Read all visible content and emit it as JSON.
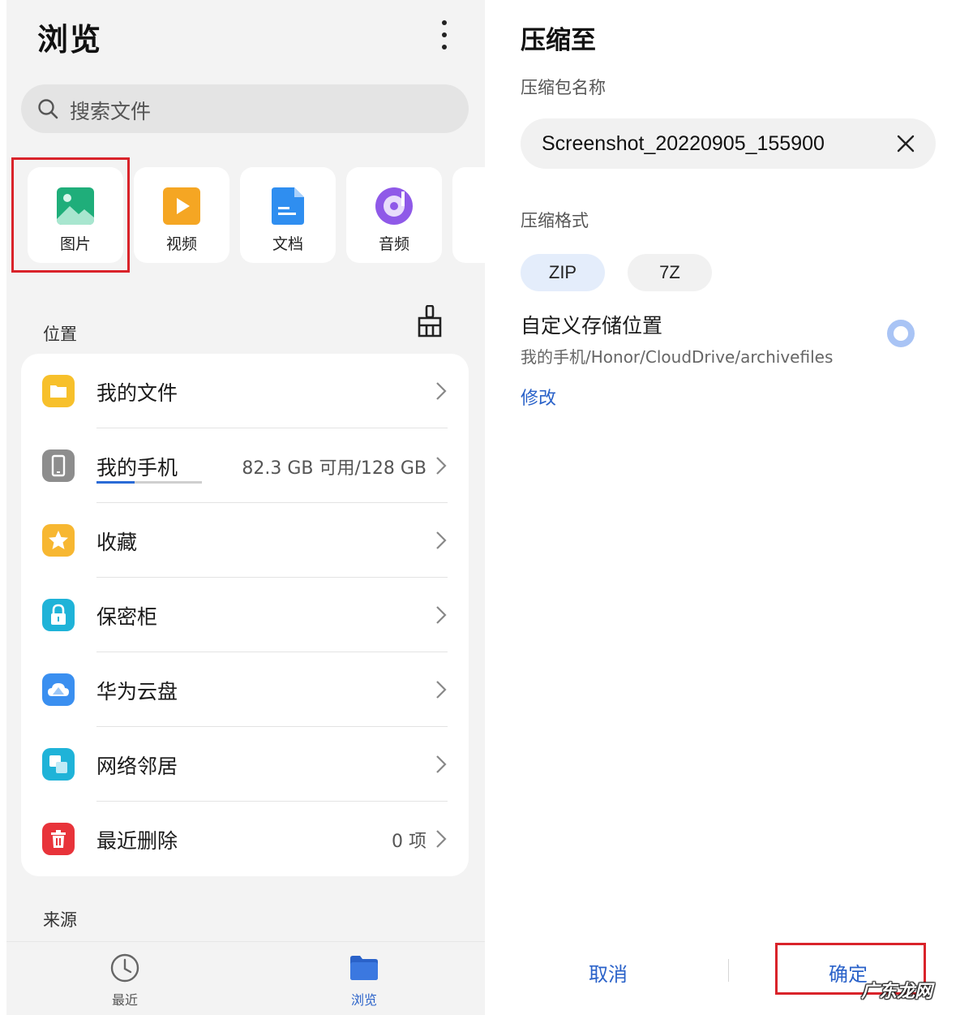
{
  "browse": {
    "title": "浏览",
    "more_icon": "more-vertical-icon",
    "search": {
      "placeholder": "搜索文件",
      "icon": "search-icon"
    },
    "categories": [
      {
        "label": "图片",
        "icon": "image-icon",
        "color": "#1fae7a"
      },
      {
        "label": "视频",
        "icon": "video-icon",
        "color": "#f5a623"
      },
      {
        "label": "文档",
        "icon": "document-icon",
        "color": "#2f8ef0"
      },
      {
        "label": "音频",
        "icon": "audio-icon",
        "color": "#8f59e8"
      }
    ],
    "location_section": "位置",
    "clean_icon": "broom-icon",
    "locations": [
      {
        "label": "我的文件",
        "icon": "folder-icon",
        "color": "#f7c02b",
        "value": ""
      },
      {
        "label": "我的手机",
        "icon": "phone-icon",
        "color": "#8d8d8d",
        "value": "82.3 GB 可用/128 GB",
        "storage_used_fraction": 0.36
      },
      {
        "label": "收藏",
        "icon": "star-icon",
        "color": "#f7b731",
        "value": ""
      },
      {
        "label": "保密柜",
        "icon": "lock-icon",
        "color": "#1fb3d8",
        "value": ""
      },
      {
        "label": "华为云盘",
        "icon": "cloud-icon",
        "color": "#3a8ff0",
        "value": ""
      },
      {
        "label": "网络邻居",
        "icon": "network-icon",
        "color": "#1fb3d8",
        "value": ""
      },
      {
        "label": "最近删除",
        "icon": "trash-icon",
        "color": "#e8333a",
        "value": "0 项"
      }
    ],
    "source_section": "来源",
    "nav": [
      {
        "label": "最近",
        "icon": "clock-icon",
        "active": false
      },
      {
        "label": "浏览",
        "icon": "folder-icon",
        "active": true
      }
    ]
  },
  "compress": {
    "title": "压缩至",
    "name_label": "压缩包名称",
    "name_value": "Screenshot_20220905_155900",
    "format_label": "压缩格式",
    "formats": [
      "ZIP",
      "7Z"
    ],
    "selected_format": "ZIP",
    "custom_location_title": "自定义存储位置",
    "custom_location_path": "我的手机/Honor/CloudDrive/archivefiles",
    "modify_label": "修改",
    "cancel_label": "取消",
    "confirm_label": "确定"
  },
  "watermark": "广东龙网",
  "colors": {
    "accent": "#2a62c9",
    "highlight": "#d9232a"
  }
}
